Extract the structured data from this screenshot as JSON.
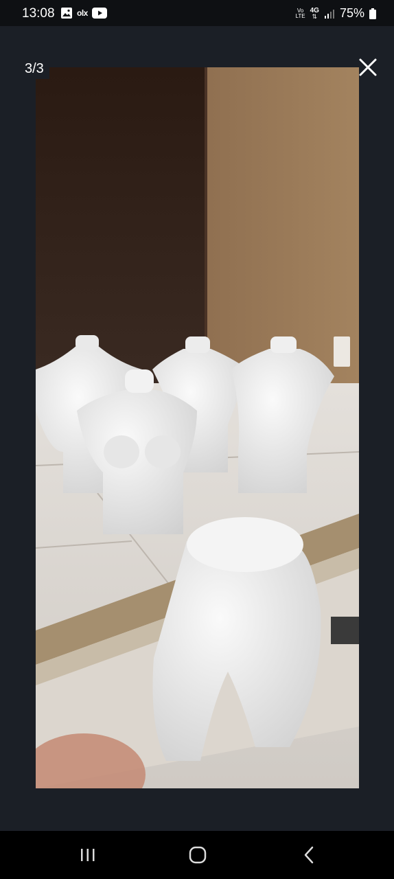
{
  "status_bar": {
    "time": "13:08",
    "notification_icons": [
      "image-icon",
      "olx-icon",
      "youtube-icon"
    ],
    "olx_text": "olx",
    "network_vo": "Vo",
    "network_lte": "LTE",
    "network_type": "4G",
    "battery_percent": "75%"
  },
  "viewer": {
    "counter": "3/3",
    "close_icon": "close-icon"
  },
  "nav_bar": {
    "recents_icon": "recents-icon",
    "home_icon": "home-icon",
    "back_icon": "back-icon"
  },
  "colors": {
    "background": "#1b1f26",
    "status_bar": "#0e1013",
    "nav_bar": "#000000"
  }
}
